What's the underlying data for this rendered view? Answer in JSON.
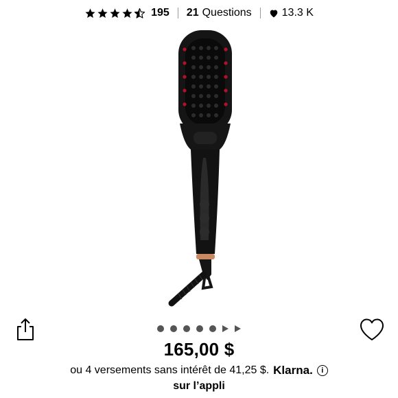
{
  "stats": {
    "rating": 4.5,
    "review_count": "195",
    "questions_count": "21",
    "questions_label": "Questions",
    "loves_count": "13.3 K"
  },
  "carousel": {
    "total_items": 7,
    "dots": 5,
    "arrows": 2,
    "active_index": 0
  },
  "product": {
    "image_icon": "heated-straightening-brush",
    "price": "165,00 $",
    "installment_text": "ou 4 versements sans intérêt de 41,25 $.",
    "installment_provider": "Klarna.",
    "app_link": "sur l’appli"
  },
  "icons": {
    "share": "share-icon",
    "wishlist": "heart-outline-icon",
    "info": "info-icon"
  },
  "colors": {
    "product_body": "#111111",
    "heating_dots": "#b0122a",
    "accent_ring": "#c98a63",
    "dot_color": "#555555"
  }
}
